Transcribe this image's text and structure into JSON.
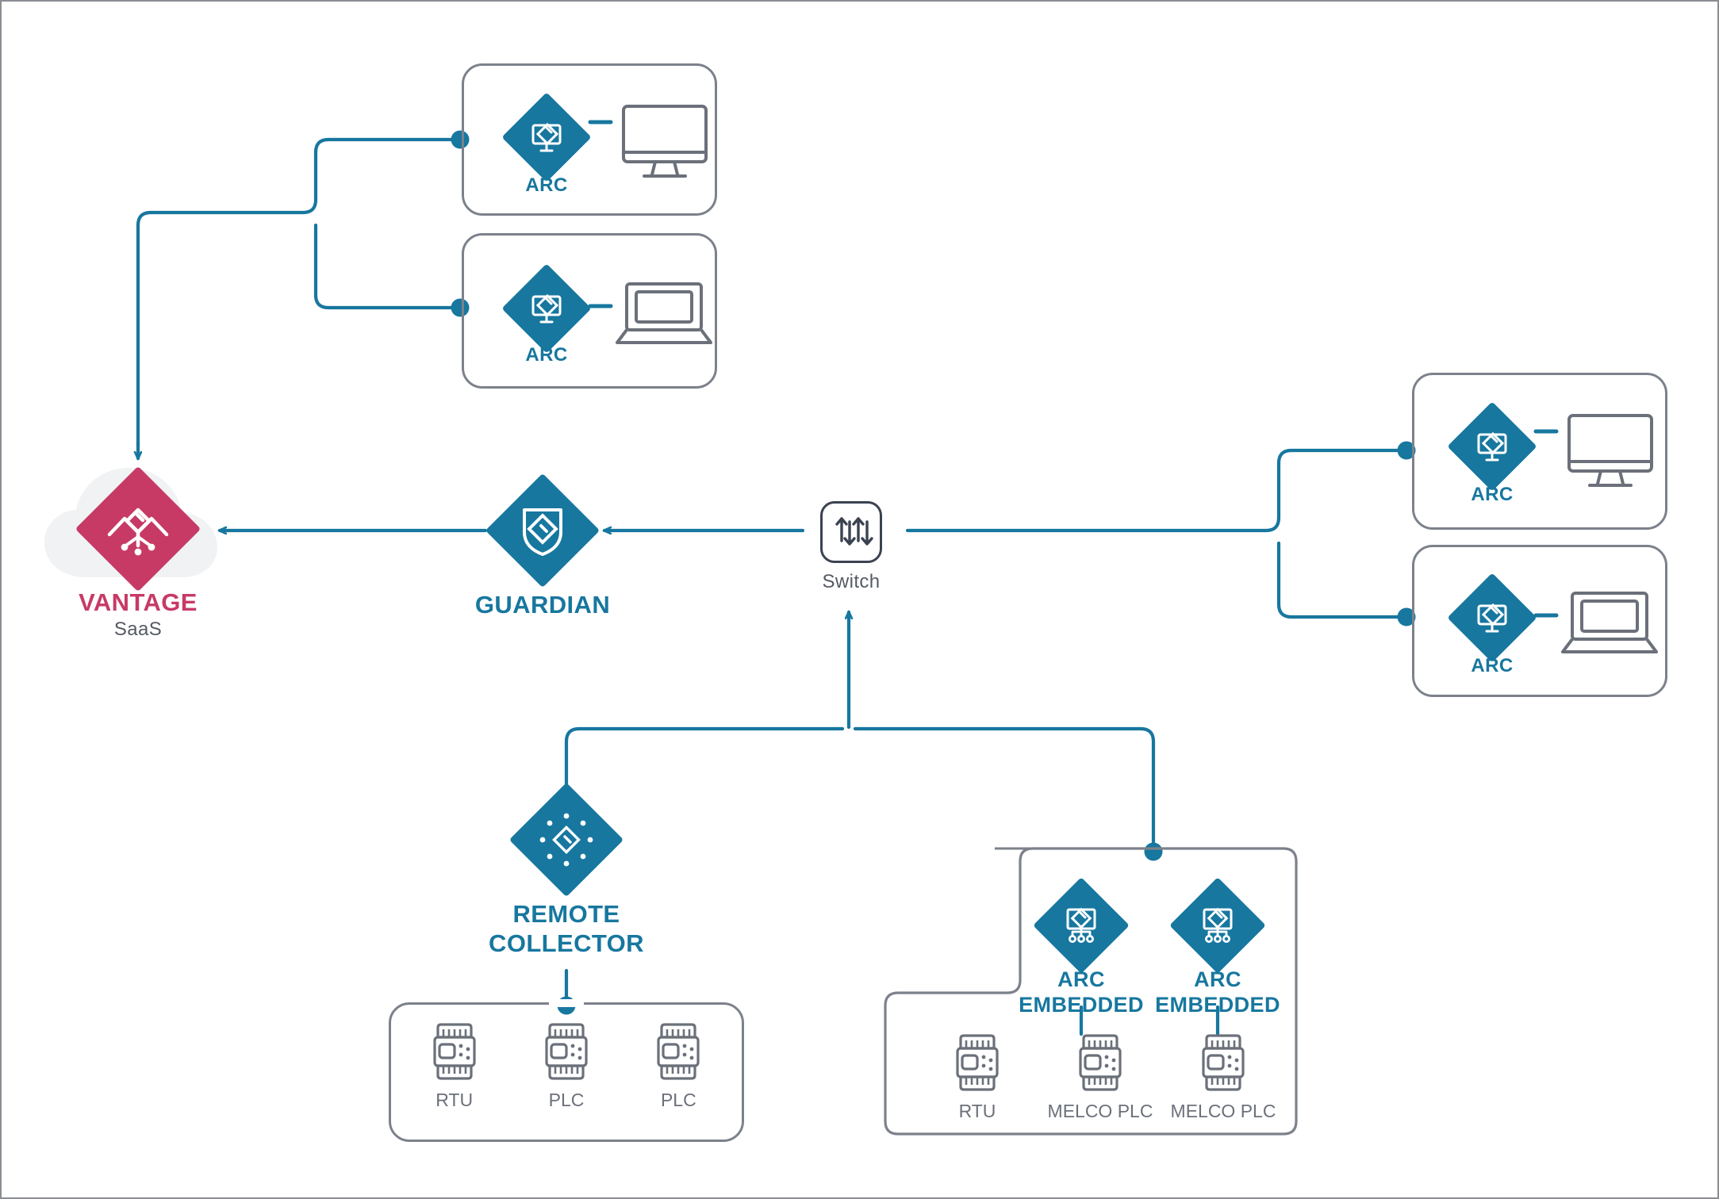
{
  "diagram": {
    "title": "Nozomi Networks architecture diagram",
    "colors": {
      "blue": "#17779f",
      "pink": "#c73a66",
      "gray_line": "#7c818b",
      "dark_gray": "#3b4250",
      "cloud": "#f1f2f4",
      "device_label": "#6b707a"
    }
  },
  "nodes": {
    "vantage": {
      "label": "VANTAGE",
      "sublabel": "SaaS",
      "icon": "vantage-cloud-diamond-icon"
    },
    "guardian": {
      "label": "GUARDIAN",
      "icon": "shield-diamond-icon"
    },
    "switch": {
      "label": "Switch",
      "icon": "switch-arrows-icon"
    },
    "remote_collector": {
      "label": "REMOTE\nCOLLECTOR",
      "icon": "remote-collector-diamond-icon"
    }
  },
  "arc_groups": [
    {
      "id": "arc-top-monitor",
      "label": "ARC",
      "icon": "arc-monitor-diamond-icon",
      "endpoint_icon": "desktop-monitor-icon"
    },
    {
      "id": "arc-top-laptop",
      "label": "ARC",
      "icon": "arc-monitor-diamond-icon",
      "endpoint_icon": "laptop-icon"
    },
    {
      "id": "arc-right-monitor",
      "label": "ARC",
      "icon": "arc-monitor-diamond-icon",
      "endpoint_icon": "desktop-monitor-icon"
    },
    {
      "id": "arc-right-laptop",
      "label": "ARC",
      "icon": "arc-monitor-diamond-icon",
      "endpoint_icon": "laptop-icon"
    }
  ],
  "arc_embedded": [
    {
      "id": "arc-embedded-1",
      "label": "ARC\nEMBEDDED",
      "icon": "arc-embedded-diamond-icon"
    },
    {
      "id": "arc-embedded-2",
      "label": "ARC\nEMBEDDED",
      "icon": "arc-embedded-diamond-icon"
    }
  ],
  "device_groups": [
    {
      "id": "remote-collector-devices",
      "devices": [
        {
          "label": "RTU",
          "icon": "plc-chip-icon"
        },
        {
          "label": "PLC",
          "icon": "plc-chip-icon"
        },
        {
          "label": "PLC",
          "icon": "plc-chip-icon"
        }
      ]
    },
    {
      "id": "arc-embedded-devices",
      "devices": [
        {
          "label": "RTU",
          "icon": "plc-chip-icon"
        },
        {
          "label": "MELCO PLC",
          "icon": "plc-chip-icon"
        },
        {
          "label": "MELCO PLC",
          "icon": "plc-chip-icon"
        }
      ]
    }
  ]
}
